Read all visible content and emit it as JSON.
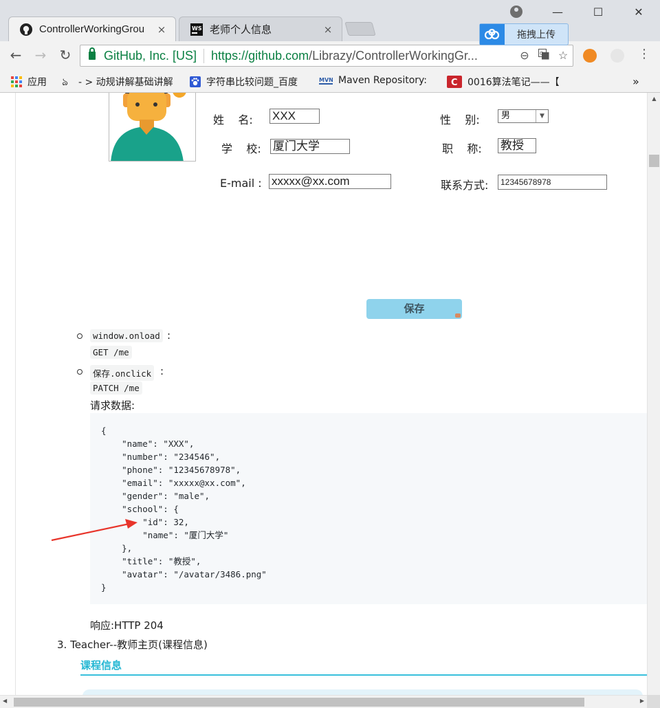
{
  "browser": {
    "tabs": [
      {
        "title": "ControllerWorkingGrou",
        "close": "×"
      },
      {
        "title": "老师个人信息",
        "close": "×"
      }
    ],
    "window_controls": {
      "minimize": "—",
      "maximize": "☐",
      "close": "✕"
    },
    "upload_label": "拖拽上传",
    "secure_label": "GitHub, Inc. [US]",
    "url_scheme_host": "https://github.com",
    "url_path": "/Librazy/ControllerWorkingGr...",
    "bookmarks": [
      {
        "label": "应用",
        "icon": "apps-grid-icon"
      },
      {
        "label": "- > 动规讲解基础讲解",
        "icon": "bookmark-icon"
      },
      {
        "label": "字符串比较问题_百度",
        "icon": "baidu-paw-icon"
      },
      {
        "label": "Maven Repository: ",
        "icon": "maven-icon"
      },
      {
        "label": "0016算法笔记——【",
        "icon": "csdn-icon"
      }
    ],
    "bookmarks_more": "»"
  },
  "form": {
    "name_label": "姓    名:",
    "name_value": "XXX",
    "gender_label": "性    别:",
    "gender_value": "男",
    "school_label": "学    校:",
    "school_value": "厦门大学",
    "title_label": "职    称:",
    "title_value": "教授",
    "email_label": "E-mail :",
    "email_value": "xxxxx@xx.com",
    "phone_label": "联系方式:",
    "phone_value": "12345678978",
    "save_label": "保存"
  },
  "doc": {
    "onload_code": "window.onload",
    "onload_colon": ":",
    "onload_request": "GET /me",
    "onclick_code": "保存.onclick",
    "onclick_colon": ":",
    "onclick_request": "PATCH /me",
    "request_data_label": "请求数据:",
    "code_lines": [
      "{",
      "    \"name\": \"XXX\",",
      "    \"number\": \"234546\",",
      "    \"phone\": \"12345678978\",",
      "    \"email\": \"xxxxx@xx.com\",",
      "    \"gender\": \"male\",",
      "    \"school\": {",
      "        \"id\": 32,",
      "        \"name\": \"厦门大学\"",
      "    },",
      "    \"title\": \"教授\",",
      "    \"avatar\": \"/avatar/3486.png\"",
      "}"
    ],
    "response_label": "响应:HTTP 204",
    "item3": "3. Teacher--教师主页(课程信息)",
    "section_title": "课程信息"
  },
  "colors": {
    "accent": "#38c0dc",
    "save_button": "#8fd3ec",
    "secure_green": "#0b8043",
    "arrow_red": "#e8352b"
  }
}
